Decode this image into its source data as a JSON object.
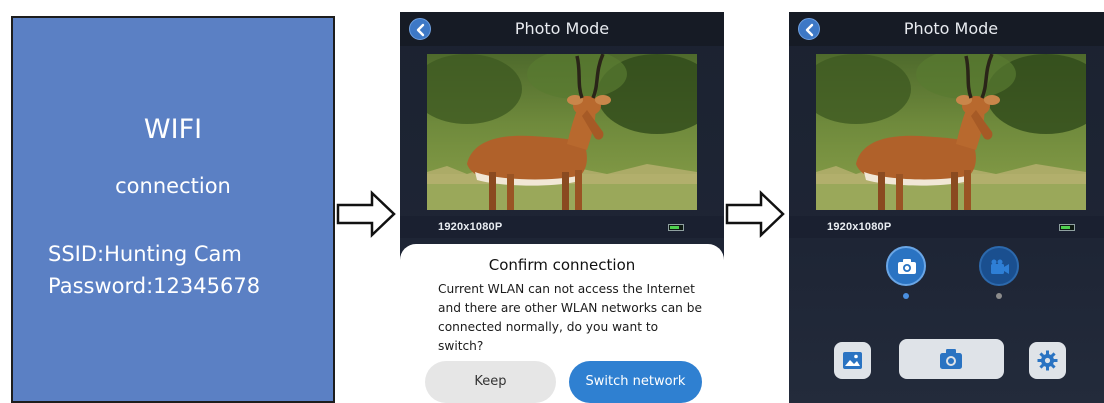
{
  "wifi_panel": {
    "title": "WIFI",
    "subtitle": "connection",
    "ssid": "SSID:Hunting Cam",
    "password": "Password:12345678"
  },
  "phone_confirm": {
    "header_title": "Photo Mode",
    "resolution": "1920x1080P",
    "battery_level": 0.75,
    "dialog": {
      "title": "Confirm connection",
      "message": "Current WLAN can not access the Internet and there are other WLAN networks can be connected normally, do you want to switch?",
      "keep_label": "Keep",
      "switch_label": "Switch network"
    }
  },
  "phone_camera": {
    "header_title": "Photo Mode",
    "resolution": "1920x1080P",
    "battery_level": 0.75,
    "modes": [
      {
        "name": "photo",
        "icon": "camera-icon",
        "selected": true
      },
      {
        "name": "video",
        "icon": "video-camera-icon",
        "selected": false
      }
    ],
    "bottom_icons": [
      "gallery-icon",
      "camera-icon",
      "settings-gear-icon"
    ]
  },
  "colors": {
    "wifi_bg": "#5b80c4",
    "phone_bg": "#1e2535",
    "accent_blue": "#2f80d1",
    "battery_green": "#4fd14f"
  }
}
